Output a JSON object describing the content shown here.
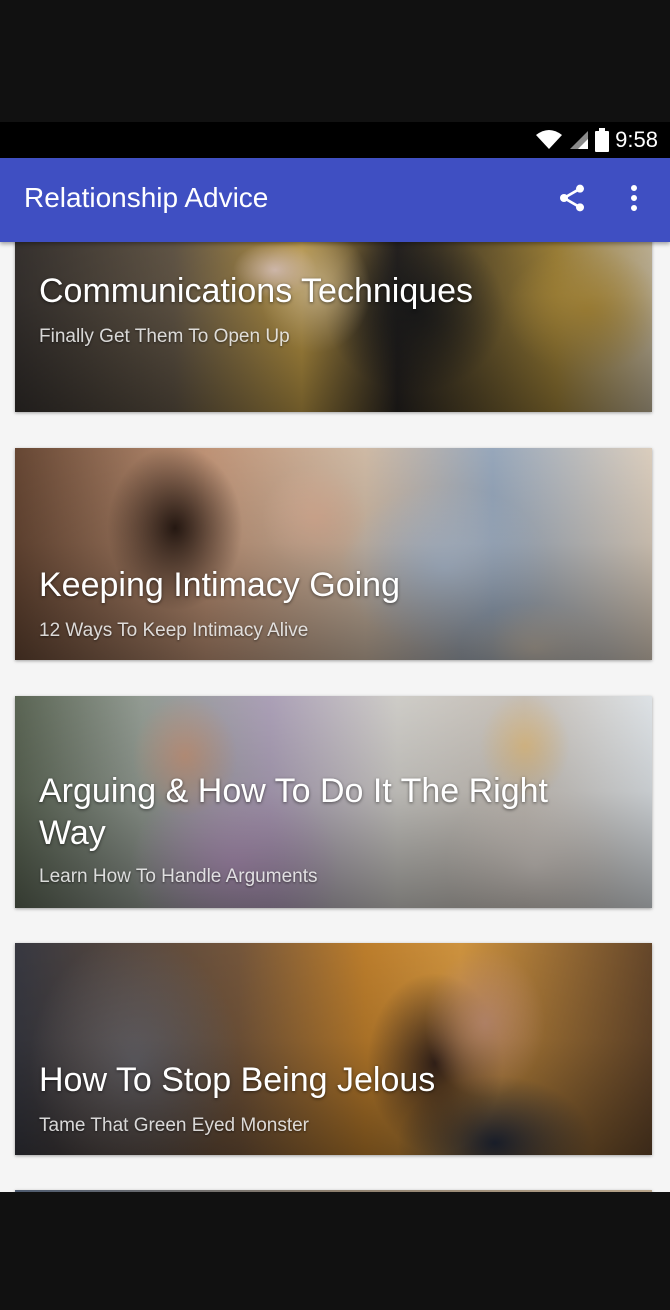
{
  "status_bar": {
    "time": "9:58",
    "icons": [
      "wifi-icon",
      "cell-signal-icon",
      "battery-icon"
    ]
  },
  "app_bar": {
    "title": "Relationship Advice",
    "background": "#3f4fc2",
    "actions": [
      "share-icon",
      "more-vert-icon"
    ]
  },
  "articles": [
    {
      "title": "Communications Techniques",
      "subtitle": "Finally Get Them To Open Up"
    },
    {
      "title": "Keeping Intimacy Going",
      "subtitle": "12 Ways To Keep Intimacy Alive"
    },
    {
      "title": "Arguing & How To Do It The Right Way",
      "subtitle": "Learn How To Handle Arguments"
    },
    {
      "title": "How To Stop Being Jelous",
      "subtitle": "Tame That Green Eyed Monster"
    }
  ]
}
